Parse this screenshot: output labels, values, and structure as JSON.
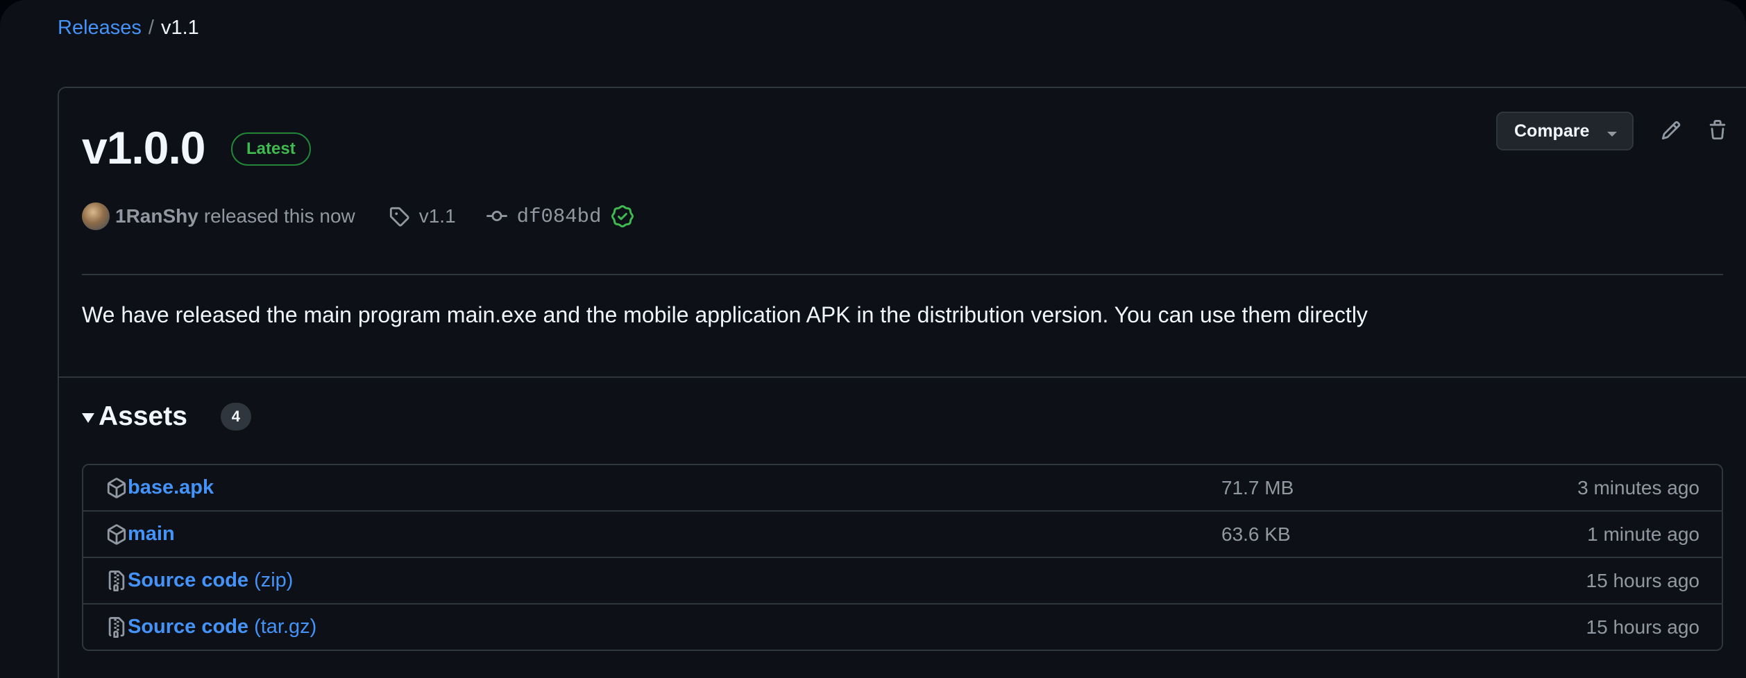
{
  "breadcrumb": {
    "releases_label": "Releases",
    "separator": "/",
    "current": "v1.1"
  },
  "release": {
    "title": "v1.0.0",
    "badge": "Latest",
    "compare_label": "Compare",
    "author": "1RanShy",
    "released_text": "released this now",
    "tag": "v1.1",
    "commit": "df084bd",
    "body": "We have released the main program main.exe and the mobile application APK in the distribution version. You can use them directly"
  },
  "assets": {
    "label": "Assets",
    "count": "4",
    "rows": [
      {
        "icon": "package-icon",
        "name": "base.apk",
        "suffix": "",
        "size": "71.7 MB",
        "time": "3 minutes ago"
      },
      {
        "icon": "package-icon",
        "name": "main",
        "suffix": "",
        "size": "63.6 KB",
        "time": "1 minute ago"
      },
      {
        "icon": "file-zip-icon",
        "name": "Source code",
        "suffix": "(zip)",
        "size": "",
        "time": "15 hours ago"
      },
      {
        "icon": "file-zip-icon",
        "name": "Source code",
        "suffix": "(tar.gz)",
        "size": "",
        "time": "15 hours ago"
      }
    ]
  },
  "colors": {
    "background": "#0d1117",
    "link": "#4493f8",
    "badge_green": "#3fb950",
    "muted": "#9198a1",
    "border": "#30363d"
  }
}
